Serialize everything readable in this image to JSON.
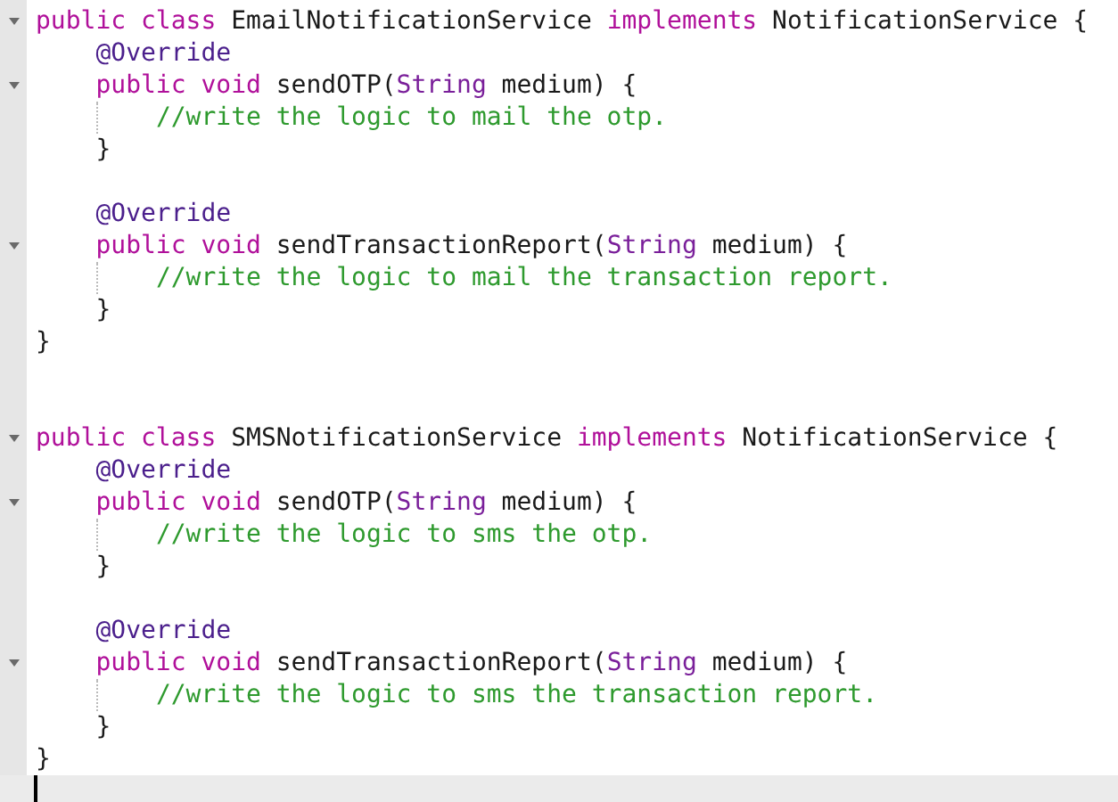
{
  "editor": {
    "lines": [
      {
        "kind": "code",
        "fold": true,
        "current": false,
        "tokens": [
          {
            "kind": "keyword",
            "text": "public class"
          },
          {
            "kind": "plain",
            "text": " EmailNotificationService "
          },
          {
            "kind": "keyword",
            "text": "implements"
          },
          {
            "kind": "plain",
            "text": " NotificationService {"
          }
        ],
        "close": "}",
        "children": [
          {
            "kind": "code",
            "fold": false,
            "current": false,
            "tokens": [
              {
                "kind": "annotation",
                "text": "@Override"
              }
            ]
          },
          {
            "kind": "code",
            "fold": true,
            "current": false,
            "tokens": [
              {
                "kind": "keyword",
                "text": "public void"
              },
              {
                "kind": "plain",
                "text": " sendOTP("
              },
              {
                "kind": "type",
                "text": "String"
              },
              {
                "kind": "plain",
                "text": " medium) {"
              }
            ],
            "close": "}",
            "children": [
              {
                "kind": "code",
                "fold": false,
                "current": false,
                "tokens": [
                  {
                    "kind": "comment",
                    "text": "//write the logic to mail the otp."
                  }
                ]
              }
            ]
          },
          {
            "kind": "blank",
            "fold": false,
            "current": false
          },
          {
            "kind": "code",
            "fold": false,
            "current": false,
            "tokens": [
              {
                "kind": "annotation",
                "text": "@Override"
              }
            ]
          },
          {
            "kind": "code",
            "fold": true,
            "current": false,
            "tokens": [
              {
                "kind": "keyword",
                "text": "public void"
              },
              {
                "kind": "plain",
                "text": " sendTransactionReport("
              },
              {
                "kind": "type",
                "text": "String"
              },
              {
                "kind": "plain",
                "text": " medium) {"
              }
            ],
            "close": "}",
            "children": [
              {
                "kind": "code",
                "fold": false,
                "current": false,
                "tokens": [
                  {
                    "kind": "comment",
                    "text": "//write the logic to mail the transaction report."
                  }
                ]
              }
            ]
          }
        ]
      },
      {
        "kind": "blank",
        "fold": false,
        "current": false
      },
      {
        "kind": "blank",
        "fold": false,
        "current": false
      },
      {
        "kind": "code",
        "fold": true,
        "current": false,
        "tokens": [
          {
            "kind": "keyword",
            "text": "public class"
          },
          {
            "kind": "plain",
            "text": " SMSNotificationService "
          },
          {
            "kind": "keyword",
            "text": "implements"
          },
          {
            "kind": "plain",
            "text": " NotificationService {"
          }
        ],
        "close": "}",
        "children": [
          {
            "kind": "code",
            "fold": false,
            "current": false,
            "tokens": [
              {
                "kind": "annotation",
                "text": "@Override"
              }
            ]
          },
          {
            "kind": "code",
            "fold": true,
            "current": false,
            "tokens": [
              {
                "kind": "keyword",
                "text": "public void"
              },
              {
                "kind": "plain",
                "text": " sendOTP("
              },
              {
                "kind": "type",
                "text": "String"
              },
              {
                "kind": "plain",
                "text": " medium) {"
              }
            ],
            "close": "}",
            "children": [
              {
                "kind": "code",
                "fold": false,
                "current": false,
                "tokens": [
                  {
                    "kind": "comment",
                    "text": "//write the logic to sms the otp."
                  }
                ]
              }
            ]
          },
          {
            "kind": "blank",
            "fold": false,
            "current": false
          },
          {
            "kind": "code",
            "fold": false,
            "current": false,
            "tokens": [
              {
                "kind": "annotation",
                "text": "@Override"
              }
            ]
          },
          {
            "kind": "code",
            "fold": true,
            "current": false,
            "tokens": [
              {
                "kind": "keyword",
                "text": "public void"
              },
              {
                "kind": "plain",
                "text": " sendTransactionReport("
              },
              {
                "kind": "type",
                "text": "String"
              },
              {
                "kind": "plain",
                "text": " medium) {"
              }
            ],
            "close": "}",
            "children": [
              {
                "kind": "code",
                "fold": false,
                "current": false,
                "tokens": [
                  {
                    "kind": "comment",
                    "text": "//write the logic to sms the transaction report."
                  }
                ]
              }
            ]
          }
        ]
      },
      {
        "kind": "blank",
        "fold": false,
        "current": true
      }
    ]
  }
}
